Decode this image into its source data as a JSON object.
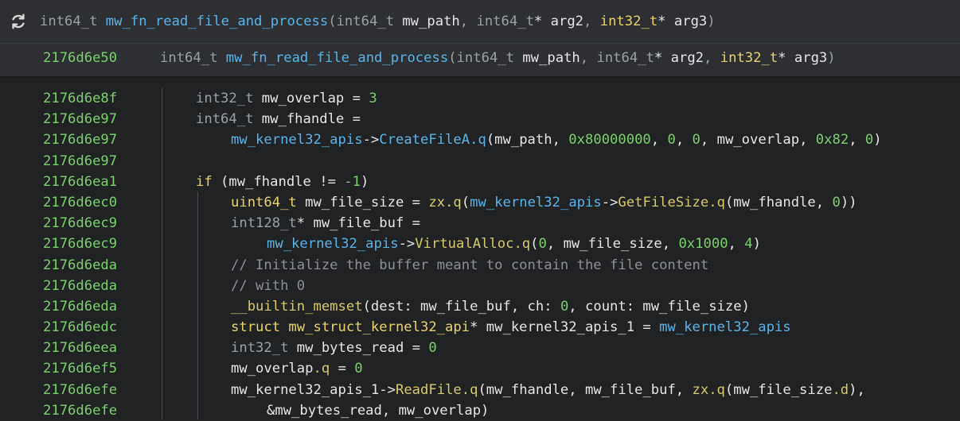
{
  "header": {
    "refresh_icon": "refresh-icon",
    "ret_type": "int64_t",
    "func_name": "mw_fn_read_file_and_process",
    "open_paren": "(",
    "p1_type": "int64_t",
    "p1_name": " mw_path",
    "sep1": ", ",
    "p2_type": "int64_t",
    "p2_ptr": "*",
    "p2_name": " arg2",
    "sep2": ", ",
    "p3_type": "int32_t",
    "p3_ptr": "*",
    "p3_name": " arg3",
    "close_paren": ")"
  },
  "func_row": {
    "address": "2176d6e50"
  },
  "colors": {
    "address": "#7bd16b",
    "function": "#5ab4e8",
    "type": "#9aa0a6",
    "keyword_type": "#e8d36a",
    "comment": "#8c8f93"
  },
  "lines": [
    {
      "addr": "2176d6e8f",
      "indent": 1,
      "tokens": [
        {
          "c": "t-type",
          "t": "int32_t"
        },
        {
          "c": "t-var",
          "t": " mw_overlap = "
        },
        {
          "c": "t-num",
          "t": "3"
        }
      ]
    },
    {
      "addr": "2176d6e97",
      "indent": 1,
      "tokens": [
        {
          "c": "t-type",
          "t": "int64_t"
        },
        {
          "c": "t-var",
          "t": " mw_fhandle ="
        }
      ]
    },
    {
      "addr": "2176d6e97",
      "indent": 2,
      "tokens": [
        {
          "c": "t-fn",
          "t": "mw_kernel32_apis"
        },
        {
          "c": "t-var",
          "t": "->"
        },
        {
          "c": "t-fn",
          "t": "CreateFileA.q"
        },
        {
          "c": "t-var",
          "t": "(mw_path, "
        },
        {
          "c": "t-num",
          "t": "0x80000000"
        },
        {
          "c": "t-var",
          "t": ", "
        },
        {
          "c": "t-num",
          "t": "0"
        },
        {
          "c": "t-var",
          "t": ", "
        },
        {
          "c": "t-num",
          "t": "0"
        },
        {
          "c": "t-var",
          "t": ", mw_overlap, "
        },
        {
          "c": "t-num",
          "t": "0x82"
        },
        {
          "c": "t-var",
          "t": ", "
        },
        {
          "c": "t-num",
          "t": "0"
        },
        {
          "c": "t-var",
          "t": ")"
        }
      ]
    },
    {
      "addr": "2176d6e97",
      "indent": 1,
      "tokens": []
    },
    {
      "addr": "2176d6ea1",
      "indent": 1,
      "tokens": [
        {
          "c": "t-kw",
          "t": "if"
        },
        {
          "c": "t-var",
          "t": " (mw_fhandle != "
        },
        {
          "c": "t-num",
          "t": "-1"
        },
        {
          "c": "t-var",
          "t": ")"
        }
      ]
    },
    {
      "addr": "2176d6ec0",
      "indent": 2,
      "tokens": [
        {
          "c": "t-kw",
          "t": "uint64_t"
        },
        {
          "c": "t-var",
          "t": " mw_file_size = "
        },
        {
          "c": "t-ident",
          "t": "zx.q"
        },
        {
          "c": "t-var",
          "t": "("
        },
        {
          "c": "t-fn",
          "t": "mw_kernel32_apis"
        },
        {
          "c": "t-var",
          "t": "->"
        },
        {
          "c": "t-ident",
          "t": "GetFileSize.q"
        },
        {
          "c": "t-var",
          "t": "(mw_fhandle, "
        },
        {
          "c": "t-num",
          "t": "0"
        },
        {
          "c": "t-var",
          "t": "))"
        }
      ]
    },
    {
      "addr": "2176d6ec9",
      "indent": 2,
      "tokens": [
        {
          "c": "t-type",
          "t": "int128_t"
        },
        {
          "c": "t-var",
          "t": "* mw_file_buf ="
        }
      ]
    },
    {
      "addr": "2176d6ec9",
      "indent": 3,
      "tokens": [
        {
          "c": "t-fn",
          "t": "mw_kernel32_apis"
        },
        {
          "c": "t-var",
          "t": "->"
        },
        {
          "c": "t-ident",
          "t": "VirtualAlloc.q"
        },
        {
          "c": "t-var",
          "t": "("
        },
        {
          "c": "t-num",
          "t": "0"
        },
        {
          "c": "t-var",
          "t": ", mw_file_size, "
        },
        {
          "c": "t-num",
          "t": "0x1000"
        },
        {
          "c": "t-var",
          "t": ", "
        },
        {
          "c": "t-num",
          "t": "4"
        },
        {
          "c": "t-var",
          "t": ")"
        }
      ]
    },
    {
      "addr": "2176d6eda",
      "indent": 2,
      "tokens": [
        {
          "c": "t-cmt",
          "t": "// Initialize the buffer meant to contain the file content"
        }
      ]
    },
    {
      "addr": "2176d6eda",
      "indent": 2,
      "tokens": [
        {
          "c": "t-cmt",
          "t": "// with 0"
        }
      ]
    },
    {
      "addr": "2176d6eda",
      "indent": 2,
      "tokens": [
        {
          "c": "t-ident",
          "t": "__builtin_memset"
        },
        {
          "c": "t-var",
          "t": "(dest: mw_file_buf, ch: "
        },
        {
          "c": "t-num",
          "t": "0"
        },
        {
          "c": "t-var",
          "t": ", count: mw_file_size)"
        }
      ]
    },
    {
      "addr": "2176d6edc",
      "indent": 2,
      "tokens": [
        {
          "c": "t-kw",
          "t": "struct mw_struct_kernel32_api"
        },
        {
          "c": "t-var",
          "t": "* mw_kernel32_apis_1 = "
        },
        {
          "c": "t-fn",
          "t": "mw_kernel32_apis"
        }
      ]
    },
    {
      "addr": "2176d6eea",
      "indent": 2,
      "tokens": [
        {
          "c": "t-type",
          "t": "int32_t"
        },
        {
          "c": "t-var",
          "t": " mw_bytes_read = "
        },
        {
          "c": "t-num",
          "t": "0"
        }
      ]
    },
    {
      "addr": "2176d6ef5",
      "indent": 2,
      "tokens": [
        {
          "c": "t-var",
          "t": "mw_overlap"
        },
        {
          "c": "t-ident",
          "t": ".q"
        },
        {
          "c": "t-var",
          "t": " = "
        },
        {
          "c": "t-num",
          "t": "0"
        }
      ]
    },
    {
      "addr": "2176d6efe",
      "indent": 2,
      "tokens": [
        {
          "c": "t-var",
          "t": "mw_kernel32_apis_1->"
        },
        {
          "c": "t-ident",
          "t": "ReadFile.q"
        },
        {
          "c": "t-var",
          "t": "(mw_fhandle, mw_file_buf, "
        },
        {
          "c": "t-ident",
          "t": "zx.q"
        },
        {
          "c": "t-var",
          "t": "(mw_file_size"
        },
        {
          "c": "t-ident",
          "t": ".d"
        },
        {
          "c": "t-var",
          "t": "),"
        }
      ]
    },
    {
      "addr": "2176d6efe",
      "indent": 3,
      "tokens": [
        {
          "c": "t-var",
          "t": "&mw_bytes_read, mw_overlap)"
        }
      ]
    }
  ]
}
